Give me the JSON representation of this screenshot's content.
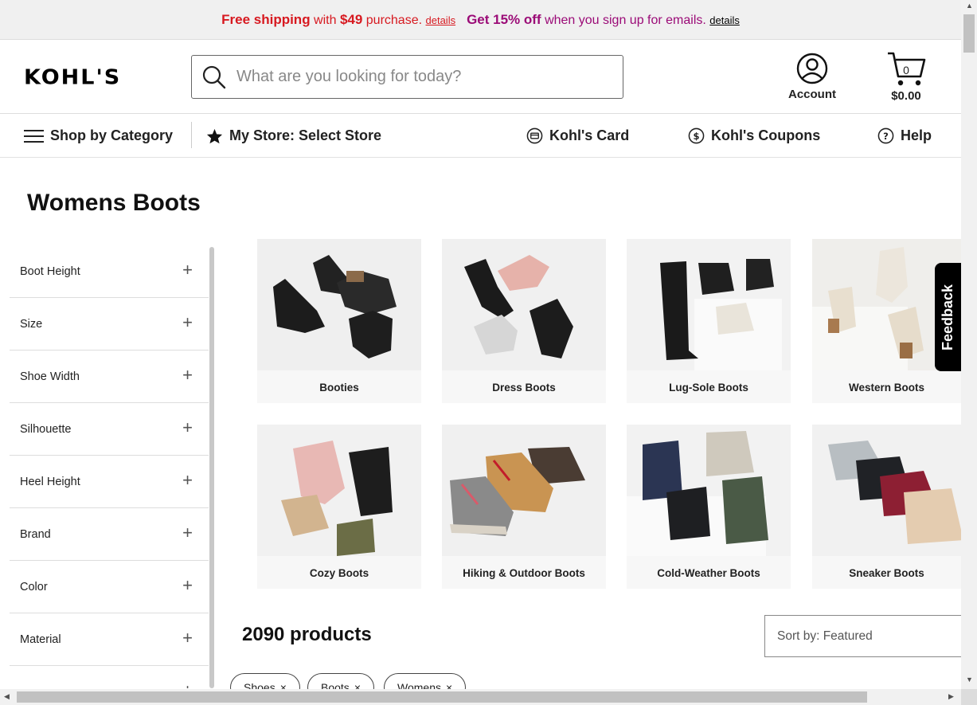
{
  "promo": {
    "free_shipping": "Free shipping",
    "with": "with",
    "amount": "$49",
    "purchase": "purchase.",
    "details1": "details",
    "get_off": "Get 15% off",
    "signup": "when you sign up for emails.",
    "details2": "details"
  },
  "header": {
    "logo": "KOHL'S",
    "search_placeholder": "What are you looking for today?",
    "account_label": "Account",
    "cart_count": "0",
    "cart_total": "$0.00"
  },
  "nav": {
    "shop_by_category": "Shop by Category",
    "my_store": "My Store: Select Store",
    "kohls_card": "Kohl's Card",
    "kohls_coupons": "Kohl's Coupons",
    "help": "Help"
  },
  "page": {
    "title": "Womens Boots",
    "product_count": "2090 products",
    "sort_label": "Sort by: Featured"
  },
  "filters": [
    "Boot Height",
    "Size",
    "Shoe Width",
    "Silhouette",
    "Heel Height",
    "Brand",
    "Color",
    "Material"
  ],
  "categories": [
    {
      "label": "Booties"
    },
    {
      "label": "Dress Boots"
    },
    {
      "label": "Lug-Sole Boots"
    },
    {
      "label": "Western Boots"
    },
    {
      "label": "Cozy Boots"
    },
    {
      "label": "Hiking & Outdoor Boots"
    },
    {
      "label": "Cold-Weather Boots"
    },
    {
      "label": "Sneaker Boots"
    }
  ],
  "chips": [
    "Shoes",
    "Boots",
    "Womens"
  ],
  "feedback": "Feedback",
  "colors": {
    "promo_red": "#d71920",
    "promo_pink": "#9b0b77"
  }
}
